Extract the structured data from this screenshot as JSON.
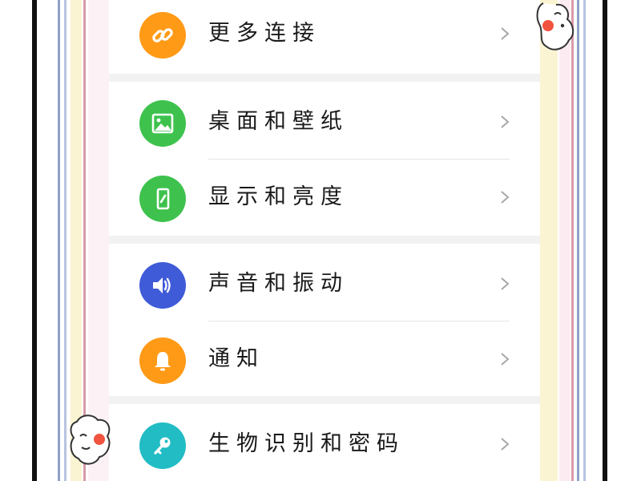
{
  "settings": {
    "items": [
      {
        "label": "更多连接",
        "icon": "link-icon",
        "color": "#ff9a16"
      },
      {
        "label": "桌面和壁纸",
        "icon": "image-icon",
        "color": "#3ec24d"
      },
      {
        "label": "显示和亮度",
        "icon": "phone-brightness-icon",
        "color": "#3ec24d"
      },
      {
        "label": "声音和振动",
        "icon": "speaker-icon",
        "color": "#3f5bd8"
      },
      {
        "label": "通知",
        "icon": "bell-icon",
        "color": "#ff9a16"
      },
      {
        "label": "生物识别和密码",
        "icon": "key-icon",
        "color": "#21bcc4"
      }
    ],
    "chevron": "chevron-right-icon"
  },
  "colors": {
    "orange": "#ff9a16",
    "green": "#3ec24d",
    "blue": "#3f5bd8",
    "teal": "#21bcc4",
    "panel_bg": "#f2f2f2"
  }
}
